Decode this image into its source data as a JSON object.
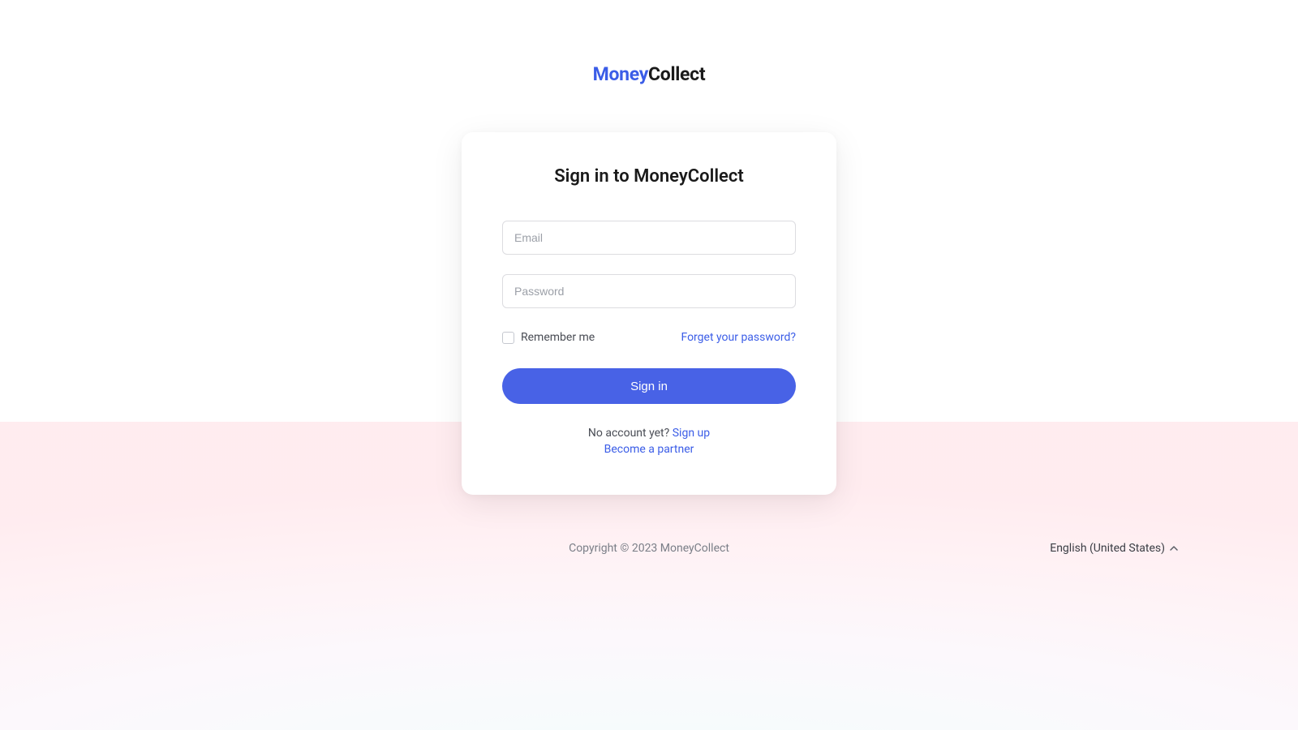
{
  "logo": {
    "part1": "Money",
    "part2": "Collect"
  },
  "card": {
    "title": "Sign in to MoneyCollect",
    "email_placeholder": "Email",
    "email_value": "",
    "password_placeholder": "Password",
    "password_value": "",
    "remember_label": "Remember me",
    "forgot_label": "Forget your password?",
    "signin_label": "Sign in",
    "no_account_text": "No account yet? ",
    "signup_label": "Sign up",
    "partner_label": "Become a partner"
  },
  "footer": {
    "copyright": "Copyright © 2023 MoneyCollect",
    "language": "English (United States)"
  }
}
